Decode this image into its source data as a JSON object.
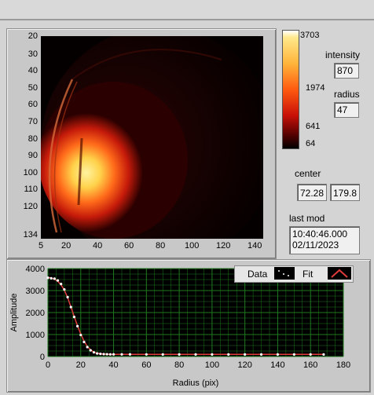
{
  "image_panel": {
    "y_ticks": [
      "20",
      "30",
      "40",
      "50",
      "60",
      "70",
      "80",
      "90",
      "100",
      "110",
      "120",
      "134"
    ],
    "x_ticks": [
      "5",
      "20",
      "40",
      "60",
      "80",
      "100",
      "120",
      "140"
    ]
  },
  "colorbar": {
    "labels": [
      "3703",
      "1974",
      "641",
      "64"
    ]
  },
  "side": {
    "intensity_label": "intensity",
    "intensity_value": "870",
    "radius_label": "radius",
    "radius_value": "47",
    "center_label": "center",
    "center_x": "72.28",
    "center_y": "179.8",
    "lastmod_label": "last mod",
    "lastmod_time": "10:40:46.000",
    "lastmod_date": "02/11/2023"
  },
  "chart_data": {
    "type": "scatter",
    "xlabel": "Radius (pix)",
    "ylabel": "Amplitude",
    "xlim": [
      0,
      180
    ],
    "ylim": [
      0,
      4000
    ],
    "x_ticks": [
      0,
      20,
      40,
      60,
      80,
      100,
      120,
      140,
      160,
      180
    ],
    "y_ticks": [
      0,
      1000,
      2000,
      3000,
      4000
    ],
    "legend_position": "top-right",
    "series": [
      {
        "name": "Data",
        "x": [
          0,
          2,
          4,
          6,
          8,
          10,
          12,
          14,
          16,
          18,
          20,
          22,
          24,
          26,
          28,
          30,
          32,
          34,
          36,
          38,
          40,
          45,
          50,
          60,
          70,
          80,
          90,
          100,
          110,
          120,
          130,
          140,
          150,
          160,
          168
        ],
        "y": [
          3580,
          3560,
          3540,
          3460,
          3300,
          3050,
          2700,
          2250,
          1800,
          1380,
          980,
          660,
          430,
          280,
          190,
          140,
          120,
          110,
          105,
          100,
          100,
          98,
          97,
          96,
          95,
          95,
          95,
          95,
          95,
          95,
          95,
          95,
          95,
          95,
          95
        ]
      },
      {
        "name": "Fit",
        "x": [
          0,
          2,
          4,
          6,
          8,
          10,
          12,
          14,
          16,
          18,
          20,
          22,
          24,
          26,
          28,
          30,
          32,
          34,
          36,
          38,
          40,
          45,
          50,
          60,
          70,
          80,
          90,
          100,
          110,
          120,
          130,
          140,
          150,
          160,
          168
        ],
        "y": [
          3600,
          3570,
          3520,
          3420,
          3260,
          3020,
          2680,
          2260,
          1820,
          1400,
          1020,
          700,
          460,
          300,
          200,
          150,
          125,
          112,
          105,
          100,
          99,
          98,
          97,
          96,
          95,
          95,
          95,
          95,
          95,
          95,
          95,
          95,
          95,
          95,
          95
        ]
      }
    ]
  },
  "colors": {
    "plot_bg": "#000000",
    "grid": "#1f7a1f",
    "data_point": "#ffffff",
    "fit_line": "#e03b3b"
  }
}
